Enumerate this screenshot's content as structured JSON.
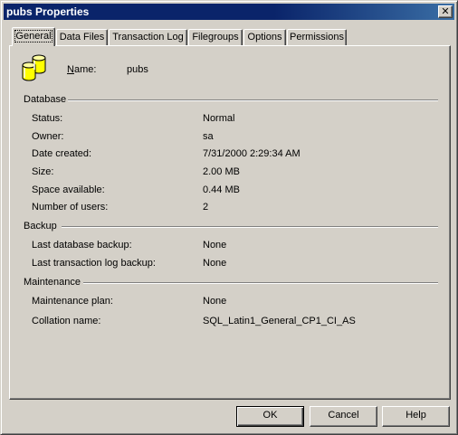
{
  "window": {
    "title": "pubs Properties",
    "close_label": "✕"
  },
  "tabs": [
    {
      "label": "General",
      "active": true
    },
    {
      "label": "Data Files"
    },
    {
      "label": "Transaction Log"
    },
    {
      "label": "Filegroups"
    },
    {
      "label": "Options"
    },
    {
      "label": "Permissions"
    }
  ],
  "general": {
    "name_label_accel": "N",
    "name_label_rest": "ame:",
    "name_value": "pubs",
    "database_section": "Database",
    "database_rows": [
      {
        "label": "Status:",
        "value": "Normal"
      },
      {
        "label": "Owner:",
        "value": "sa"
      },
      {
        "label": "Date created:",
        "value": "7/31/2000 2:29:34 AM"
      },
      {
        "label": "Size:",
        "value": "2.00 MB"
      },
      {
        "label": "Space available:",
        "value": "0.44 MB"
      },
      {
        "label": "Number of users:",
        "value": "2"
      }
    ],
    "backup_section": "Backup",
    "backup_rows": [
      {
        "label": "Last database backup:",
        "value": "None"
      },
      {
        "label": "Last transaction log backup:",
        "value": "None"
      }
    ],
    "maintenance_section": "Maintenance",
    "maintenance_rows": [
      {
        "label": "Maintenance plan:",
        "value": "None"
      },
      {
        "label": "Collation name:",
        "value": "SQL_Latin1_General_CP1_CI_AS"
      }
    ]
  },
  "buttons": {
    "ok": "OK",
    "cancel": "Cancel",
    "help": "Help"
  },
  "colors": {
    "titlebar": "#0a246a",
    "face": "#d4d0c8",
    "icon_yellow": "#ffff00"
  },
  "icons": {
    "database": "database-icon",
    "close": "close-icon"
  }
}
